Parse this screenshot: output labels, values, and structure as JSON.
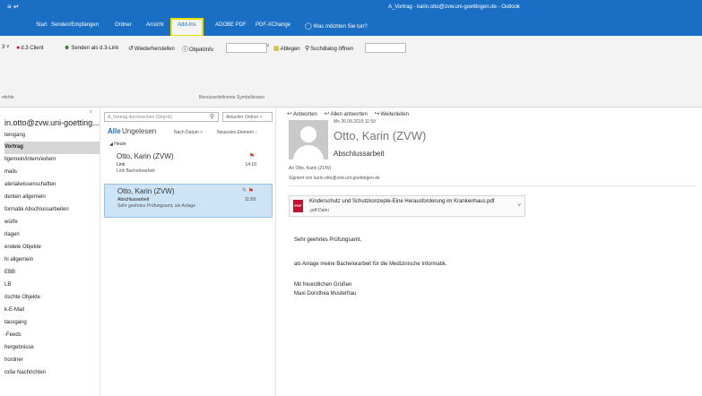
{
  "window": {
    "quick_access": "≡ ↵",
    "title": "A_Vortrag - karin.otto@zvw.uni-goettingen.de - Outlook"
  },
  "tabs": [
    {
      "label": "Start"
    },
    {
      "label": "Senden/Empfangen"
    },
    {
      "label": "Ordner"
    },
    {
      "label": "Ansicht"
    },
    {
      "label": "Add-Ins"
    },
    {
      "label": "ADOBE PDF"
    },
    {
      "label": "PDF-XChange"
    },
    {
      "label": "Was möchten Sie tun?"
    }
  ],
  "active_tab_color": "#f3f3f3",
  "highlight_color": "#e8e000",
  "toolbar": {
    "prefix": "3 ˅",
    "items": [
      {
        "label": "d.3 Client"
      },
      {
        "label": "Senden als d.3-Link"
      },
      {
        "label": "Wiederherstellen"
      },
      {
        "label": "Objektinfo"
      },
      {
        "label": "Ablegen"
      },
      {
        "label": "Suchdialog öffnen"
      }
    ],
    "group_caption": "Benutzerdefinierte Symbolleisten",
    "side_caption": "efehle"
  },
  "folder_pane": {
    "account": "in.otto@zvw.uni-goetting...",
    "folders": [
      "teingang",
      "Vortrag",
      "llgemein/intern/extern",
      "mails",
      "aterialwissenschaften",
      "denten allgemein",
      "formatik Abschlussarbeiten",
      "würfe",
      "rlagen",
      "endete Objekte",
      "hi allgemein",
      "EBB",
      "LB",
      "öschte Objekte",
      "k-E-Mail",
      "tausgang",
      "-Feeds",
      "hergebnisse",
      "hordner",
      "roße Nachrichten"
    ],
    "selected_index": 1
  },
  "message_list": {
    "search_placeholder": "A_Vortrag durchsuchen (Strg+E)",
    "scope": "Aktueller Ordner ˅",
    "filter_all": "Alle",
    "filter_unread": "Ungelesen",
    "sort_by": "Nach Datum ˅",
    "sort_order": "Neuestes Element ↓",
    "group": "◢ Heute",
    "mails": [
      {
        "sender": "Otto, Karin (ZVW)",
        "subject": "Link",
        "preview": "Link Bachelorarbeit",
        "time": "14:10"
      },
      {
        "sender": "Otto, Karin (ZVW)",
        "subject": "Abschlussarbeit",
        "preview": "Sehr geehrtes Prüfungsamt,  als Anlage",
        "time": "11:59"
      }
    ]
  },
  "reading_pane": {
    "reply": "Antworten",
    "reply_all": "Allen antworten",
    "forward": "Weiterleiten",
    "datetime": "Mo 26.08.2019 11:59",
    "sender": "Otto, Karin (ZVW)",
    "subject": "Abschlussarbeit",
    "to": "An   Otto, Karin (ZVW)",
    "signed": "Signiert von   karin.otto@zvw.uni-goettingen.de",
    "attachment": {
      "name": "Kinderschutz und Schutzkonzepte-Eine Herausforderung im Krankenhaus.pdf",
      "type": ".pdf-Datei",
      "badge": "PDF"
    },
    "body": [
      "Sehr geehrtes Prüfungsamt,",
      "als Anlage meine Bachelorarbeit für die Medizinische Informatik.",
      "Mit freundlichen Grüßen",
      "Maxi Dorothea Musterfrau"
    ]
  }
}
